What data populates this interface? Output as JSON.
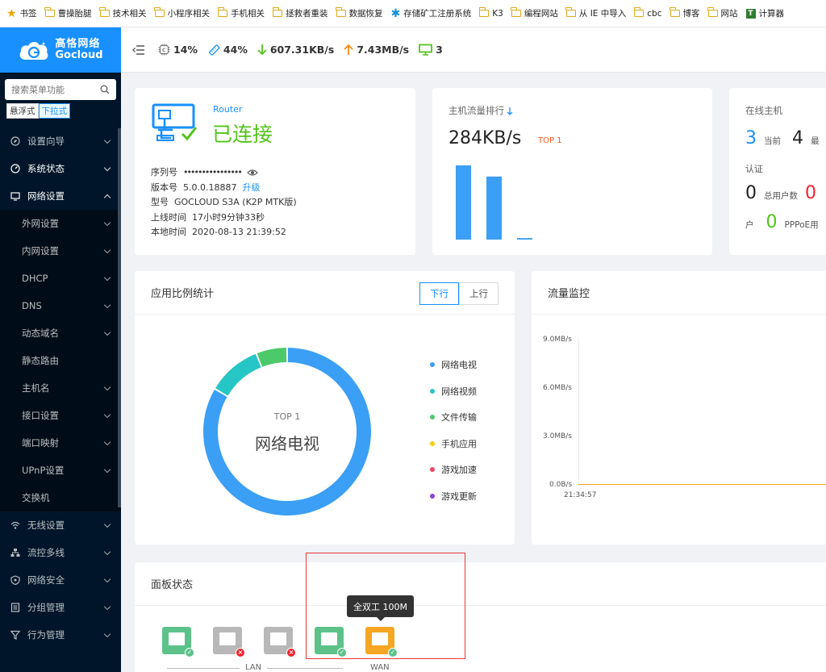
{
  "bookmarks": [
    {
      "icon": "star-icon",
      "label": "书签"
    },
    {
      "icon": "folder-icon",
      "label": "曹操胎腿"
    },
    {
      "icon": "folder-icon",
      "label": "技术相关"
    },
    {
      "icon": "folder-icon",
      "label": "小程序相关"
    },
    {
      "icon": "folder-icon",
      "label": "手机相关"
    },
    {
      "icon": "folder-icon",
      "label": "拯救者重装"
    },
    {
      "icon": "folder-icon",
      "label": "数据恢复"
    },
    {
      "icon": "snowflake-icon",
      "label": "存储矿工注册系统"
    },
    {
      "icon": "folder-icon",
      "label": "K3"
    },
    {
      "icon": "folder-icon",
      "label": "编程网站"
    },
    {
      "icon": "folder-icon",
      "label": "从 IE 中导入"
    },
    {
      "icon": "folder-icon",
      "label": "cbc"
    },
    {
      "icon": "folder-icon",
      "label": "博客"
    },
    {
      "icon": "folder-icon",
      "label": "网站"
    },
    {
      "icon": "calculator-icon",
      "label": "计算器"
    }
  ],
  "brand": {
    "name_cn": "高恪网络",
    "name_en": "Gocloud",
    "color": "#1890ff"
  },
  "search": {
    "placeholder": "搜索菜单功能"
  },
  "menu_mode": {
    "floating": "悬浮式",
    "dropdown": "下拉式"
  },
  "sidebar": {
    "items": [
      {
        "label": "设置向导",
        "icon": "compass-icon"
      },
      {
        "label": "系统状态",
        "icon": "dashboard-icon"
      },
      {
        "label": "网络设置",
        "icon": "monitor-icon"
      }
    ],
    "sub_items": [
      {
        "label": "外网设置",
        "expandable": true
      },
      {
        "label": "内网设置",
        "expandable": true
      },
      {
        "label": "DHCP",
        "expandable": true
      },
      {
        "label": "DNS",
        "expandable": true
      },
      {
        "label": "动态域名",
        "expandable": true
      },
      {
        "label": "静态路由",
        "expandable": false
      },
      {
        "label": "主机名",
        "expandable": true
      },
      {
        "label": "接口设置",
        "expandable": true
      },
      {
        "label": "端口映射",
        "expandable": true
      },
      {
        "label": "UPnP设置",
        "expandable": true
      },
      {
        "label": "交换机",
        "expandable": false
      }
    ],
    "bottom_items": [
      {
        "label": "无线设置",
        "icon": "wifi-icon"
      },
      {
        "label": "流控多线",
        "icon": "network-icon"
      },
      {
        "label": "网络安全",
        "icon": "shield-icon"
      },
      {
        "label": "分组管理",
        "icon": "group-icon"
      },
      {
        "label": "行为管理",
        "icon": "filter-icon"
      }
    ]
  },
  "topbar": {
    "cpu": "14%",
    "memory": "44%",
    "download": "607.31KB/s",
    "upload": "7.43MB/s",
    "devices": "3"
  },
  "router": {
    "label": "Router",
    "status": "已连接",
    "serial_label": "序列号",
    "serial_value": "••••••••••••••••",
    "version_label": "版本号",
    "version_value": "5.0.0.18887",
    "upgrade_link": "升级",
    "model_label": "型号",
    "model_value": "GOCLOUD S3A (K2P MTK版)",
    "uptime_label": "上线时间",
    "uptime_value": "17小时9分钟33秒",
    "localtime_label": "本地时间",
    "localtime_value": "2020-08-13 21:39:52"
  },
  "host_traffic": {
    "title": "主机流量排行",
    "value": "284KB/s",
    "rank": "TOP 1",
    "bars": [
      1.0,
      0.85,
      0.02
    ]
  },
  "online_hosts": {
    "title": "在线主机",
    "current_value": "3",
    "current_label": "当前",
    "max_value": "4",
    "max_label": "最",
    "auth_label": "认证",
    "total_value": "0",
    "total_label": "总用户数",
    "other_value": "0",
    "user_label": "户",
    "pppoe_value": "0",
    "pppoe_label": "PPPoE用"
  },
  "app_stats": {
    "title": "应用比例统计",
    "tabs": [
      "下行",
      "上行"
    ],
    "active_tab": "下行",
    "center_rank": "TOP 1",
    "center_name": "网络电视",
    "legend": [
      {
        "label": "网络电视",
        "color": "#3a9ff5"
      },
      {
        "label": "网络视频",
        "color": "#26c6c6"
      },
      {
        "label": "文件传输",
        "color": "#4cca6a"
      },
      {
        "label": "手机应用",
        "color": "#facc14"
      },
      {
        "label": "游戏加速",
        "color": "#f04864"
      },
      {
        "label": "游戏更新",
        "color": "#8543e0"
      }
    ]
  },
  "chart_data": {
    "type": "pie",
    "categories": [
      "网络电视",
      "网络视频",
      "文件传输",
      "手机应用",
      "游戏加速",
      "游戏更新"
    ],
    "values": [
      83.5,
      10.5,
      6.0,
      0,
      0,
      0
    ]
  },
  "traffic_monitor": {
    "title": "流量监控",
    "y_ticks": [
      "9.0MB/s",
      "6.0MB/s",
      "3.0MB/s",
      "0.0B/s"
    ],
    "x_tick": "21:34:57",
    "line_color": "#f5a623"
  },
  "panel": {
    "title": "面板状态",
    "ports": [
      {
        "status": "connected",
        "color": "#5cc28a",
        "badge": "check"
      },
      {
        "status": "disconnected",
        "color": "#b8b8b8",
        "badge": "cross"
      },
      {
        "status": "disconnected",
        "color": "#b8b8b8",
        "badge": "cross"
      },
      {
        "status": "connected",
        "color": "#5cc28a",
        "badge": "check"
      },
      {
        "status": "connected",
        "color": "#f5a623",
        "badge": "check"
      }
    ],
    "lan_label": "LAN",
    "wan_label": "WAN",
    "tooltip": "全双工 100M"
  }
}
